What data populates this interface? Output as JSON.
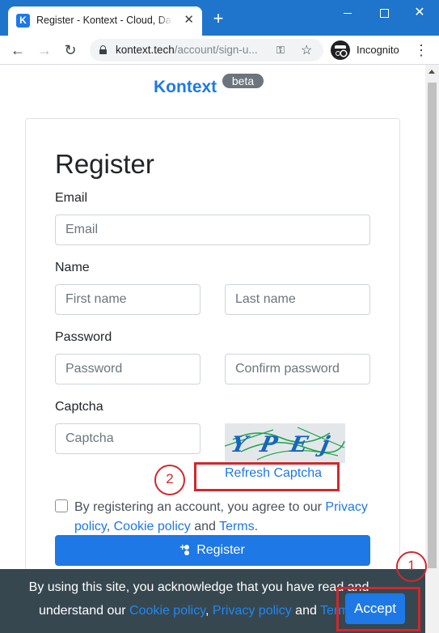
{
  "browser": {
    "tab_title": "Register - Kontext - Cloud, Data and AI",
    "tab_favicon": "K",
    "tab_close": "✕",
    "new_tab": "+",
    "close_window": "✕",
    "url_host": "kontext.tech",
    "url_path": "/account/sign-u...",
    "incognito_label": "Incognito",
    "back": "←",
    "forward": "→",
    "reload": "↻",
    "key": "⚿",
    "star": "☆",
    "menu": "⋮"
  },
  "header": {
    "brand": "Kontext",
    "badge": "beta"
  },
  "form": {
    "title": "Register",
    "email_label": "Email",
    "email_placeholder": "Email",
    "name_label": "Name",
    "first_name_placeholder": "First name",
    "last_name_placeholder": "Last name",
    "password_label": "Password",
    "password_placeholder": "Password",
    "confirm_password_placeholder": "Confirm password",
    "captcha_label": "Captcha",
    "captcha_placeholder": "Captcha",
    "captcha_image_text": "YPEj",
    "refresh_captcha": "Refresh Captcha",
    "agree_prefix": "By registering an account, you agree to our ",
    "privacy_link": "Privacy policy",
    "comma": ", ",
    "cookie_link": "Cookie policy",
    "and": " and ",
    "terms_link": "Terms",
    "period": ".",
    "register_button": "Register"
  },
  "cookie_banner": {
    "text_part1": "By using this site, you acknowledge that you have read and understand our ",
    "cookie_link": "Cookie policy",
    "sep": ", ",
    "privacy_link": "Privacy policy",
    "and": " and ",
    "terms_link": "Terms",
    "period": ".",
    "accept_button": "Accept"
  },
  "annotations": {
    "marker_1": "1",
    "marker_2": "2",
    "color": "#d0282c"
  },
  "colors": {
    "primary": "#1e78e6",
    "chrome": "#1f75cb",
    "banner": "#37474f"
  }
}
